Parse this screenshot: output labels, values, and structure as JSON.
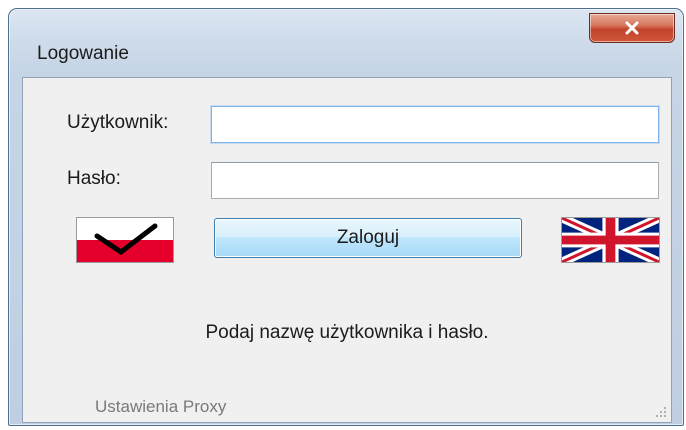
{
  "window": {
    "title": "Logowanie",
    "close_label": "Zamknij"
  },
  "form": {
    "username_label": "Użytkownik:",
    "username_value": "",
    "password_label": "Hasło:",
    "password_value": "",
    "login_button": "Zaloguj"
  },
  "status_text": "Podaj nazwę użytkownika i hasło.",
  "proxy_link": "Ustawienia Proxy",
  "languages": [
    {
      "code": "pl",
      "icon": "polish-flag-icon",
      "selected": true
    },
    {
      "code": "en",
      "icon": "uk-flag-icon",
      "selected": false
    }
  ],
  "colors": {
    "close_red": "#c1442a",
    "focus_border": "#7eb4ea",
    "button_border": "#3c7fb1",
    "poland_red": "#e4002b",
    "uk_blue": "#00247d",
    "uk_red": "#cf142b"
  }
}
